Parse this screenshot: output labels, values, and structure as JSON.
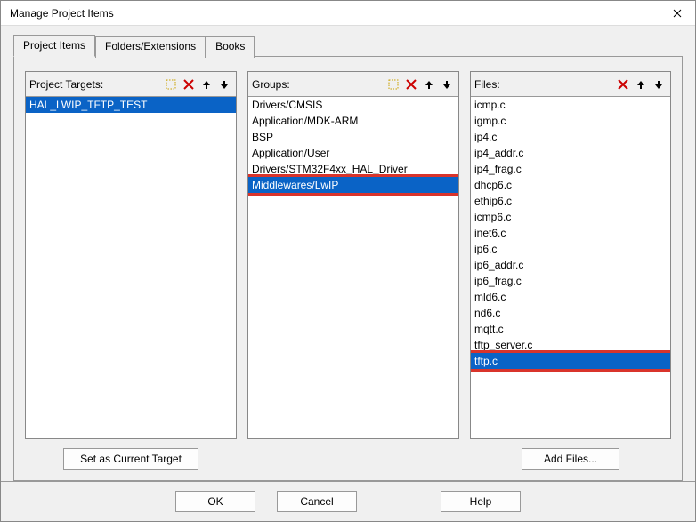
{
  "window": {
    "title": "Manage Project Items"
  },
  "tabs": {
    "items": [
      {
        "label": "Project Items",
        "active": true
      },
      {
        "label": "Folders/Extensions",
        "active": false
      },
      {
        "label": "Books",
        "active": false
      }
    ]
  },
  "columns": {
    "targets": {
      "header": "Project Targets:",
      "items": [
        "HAL_LWIP_TFTP_TEST"
      ],
      "selected_index": 0,
      "button": "Set as Current Target"
    },
    "groups": {
      "header": "Groups:",
      "items": [
        "Drivers/CMSIS",
        "Application/MDK-ARM",
        "BSP",
        "Application/User",
        "Drivers/STM32F4xx_HAL_Driver",
        "Middlewares/LwIP"
      ],
      "selected_index": 5,
      "highlight_index": 5
    },
    "files": {
      "header": "Files:",
      "items": [
        "icmp.c",
        "igmp.c",
        "ip4.c",
        "ip4_addr.c",
        "ip4_frag.c",
        "dhcp6.c",
        "ethip6.c",
        "icmp6.c",
        "inet6.c",
        "ip6.c",
        "ip6_addr.c",
        "ip6_frag.c",
        "mld6.c",
        "nd6.c",
        "mqtt.c",
        "tftp_server.c",
        "tftp.c"
      ],
      "selected_index": 16,
      "highlight_index": 16,
      "button": "Add Files..."
    }
  },
  "footer": {
    "ok": "OK",
    "cancel": "Cancel",
    "help": "Help"
  }
}
